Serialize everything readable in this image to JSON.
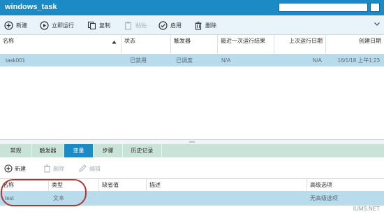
{
  "titlebar": {
    "title": "windows_task",
    "search_value": ""
  },
  "toolbar": {
    "new": "新建",
    "run_now": "立即运行",
    "copy": "复制",
    "paste": "粘贴",
    "enable": "启用",
    "delete": "删除"
  },
  "grid": {
    "headers": [
      "名称",
      "状态",
      "触发器",
      "最近一次运行结果",
      "上次运行日期",
      "创建日期"
    ],
    "rows": [
      {
        "name": "task001",
        "status": "已禁用",
        "trigger": "已调度",
        "last_result": "N/A",
        "last_run": "N/A",
        "created": "16/1/18 上午1:23"
      }
    ]
  },
  "tabs": [
    "常规",
    "触发器",
    "变量",
    "步骤",
    "历史记录"
  ],
  "active_tab": "变量",
  "variables_toolbar": {
    "new": "新建",
    "delete": "删除",
    "edit": "编辑"
  },
  "variables": {
    "headers": [
      "名称",
      "类型",
      "缺省值",
      "描述",
      "高级选项"
    ],
    "rows": [
      {
        "name": "test",
        "type": "文本",
        "default": "",
        "description": "",
        "advanced": "无高级选项"
      }
    ]
  },
  "watermark": "IUMS.NET",
  "colors": {
    "accent": "#1c8ac4",
    "selection": "#b9dcec",
    "tabbar": "#c9e3d9",
    "highlight_oval": "#b3342e"
  }
}
